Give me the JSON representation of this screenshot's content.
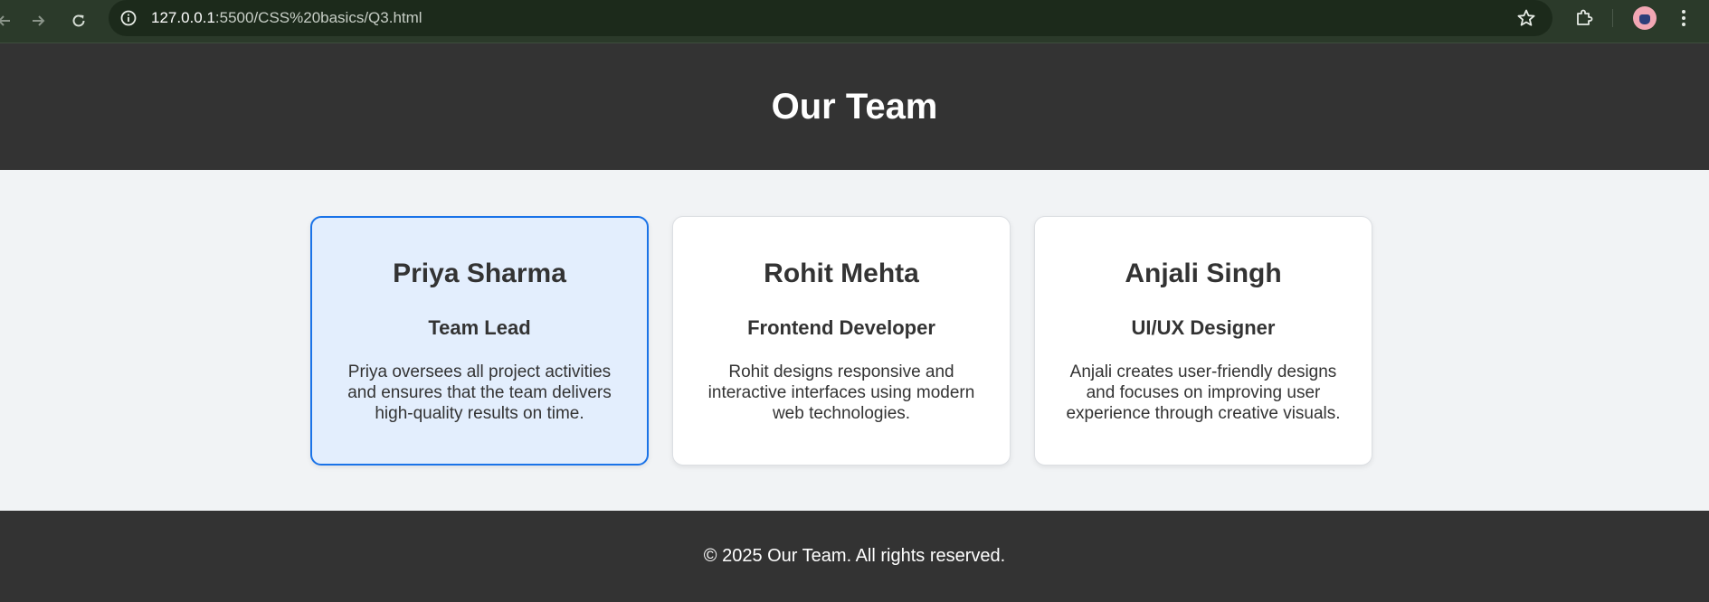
{
  "browser": {
    "url_host": "127.0.0.1",
    "url_rest": ":5500/CSS%20basics/Q3.html",
    "icons": {
      "back": "arrow-left-icon",
      "forward": "arrow-right-icon",
      "reload": "reload-icon",
      "site_info": "info-icon",
      "bookmark": "star-icon",
      "extensions": "puzzle-icon",
      "profile": "avatar",
      "menu": "kebab-menu-icon"
    }
  },
  "header": {
    "title": "Our Team"
  },
  "team": [
    {
      "name": "Priya Sharma",
      "role": "Team Lead",
      "bio": "Priya oversees all project activities and ensures that the team delivers high-quality results on time.",
      "highlighted": true
    },
    {
      "name": "Rohit Mehta",
      "role": "Frontend Developer",
      "bio": "Rohit designs responsive and interactive interfaces using modern web technologies.",
      "highlighted": false
    },
    {
      "name": "Anjali Singh",
      "role": "UI/UX Designer",
      "bio": "Anjali creates user-friendly designs and focuses on improving user experience through creative visuals.",
      "highlighted": false
    }
  ],
  "footer": {
    "text": "© 2025 Our Team. All rights reserved."
  },
  "colors": {
    "header_bg": "#333333",
    "page_bg": "#f1f3f5",
    "card_bg": "#ffffff",
    "card_highlight_bg": "#e3eefd",
    "card_highlight_border": "#1a73e8",
    "text": "#333333"
  }
}
